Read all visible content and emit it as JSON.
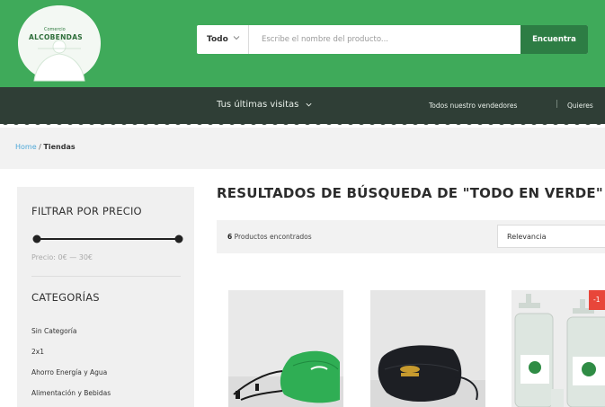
{
  "header": {
    "logo": {
      "line1": "Comercio",
      "line2": "ALCOBENDAS"
    },
    "search": {
      "category": "Todo",
      "placeholder": "Escribe el nombre del producto...",
      "button_label": "Encuentra"
    }
  },
  "nav": {
    "recent_label": "Tus últimas visitas",
    "sellers_label": "Todos nuestro vendedores",
    "separator": "|",
    "quieres_label": "Quieres"
  },
  "breadcrumb": {
    "home": "Home",
    "separator": " / ",
    "current": "Tiendas"
  },
  "sidebar": {
    "price_title": "FILTRAR POR PRECIO",
    "price_range": "Precio: 0€ — 30€",
    "categories_title": "CATEGORÍAS",
    "categories": [
      "Sin Categoría",
      "2x1",
      "Ahorro Energía y Agua",
      "Alimentación y Bebidas"
    ]
  },
  "main": {
    "results_title": "RESULTADOS DE BÚSQUEDA DE \"TODO EN VERDE\"",
    "count_number": "6",
    "count_text": " Productos encontrados",
    "sort_value": "Relevancia",
    "sale_badge": "-1"
  },
  "colors": {
    "header_green": "#3faa5a",
    "button_green": "#2d7d44",
    "nav_dark": "#2f3e36",
    "link_blue": "#4fa8d8",
    "sale_red": "#e8463a"
  }
}
